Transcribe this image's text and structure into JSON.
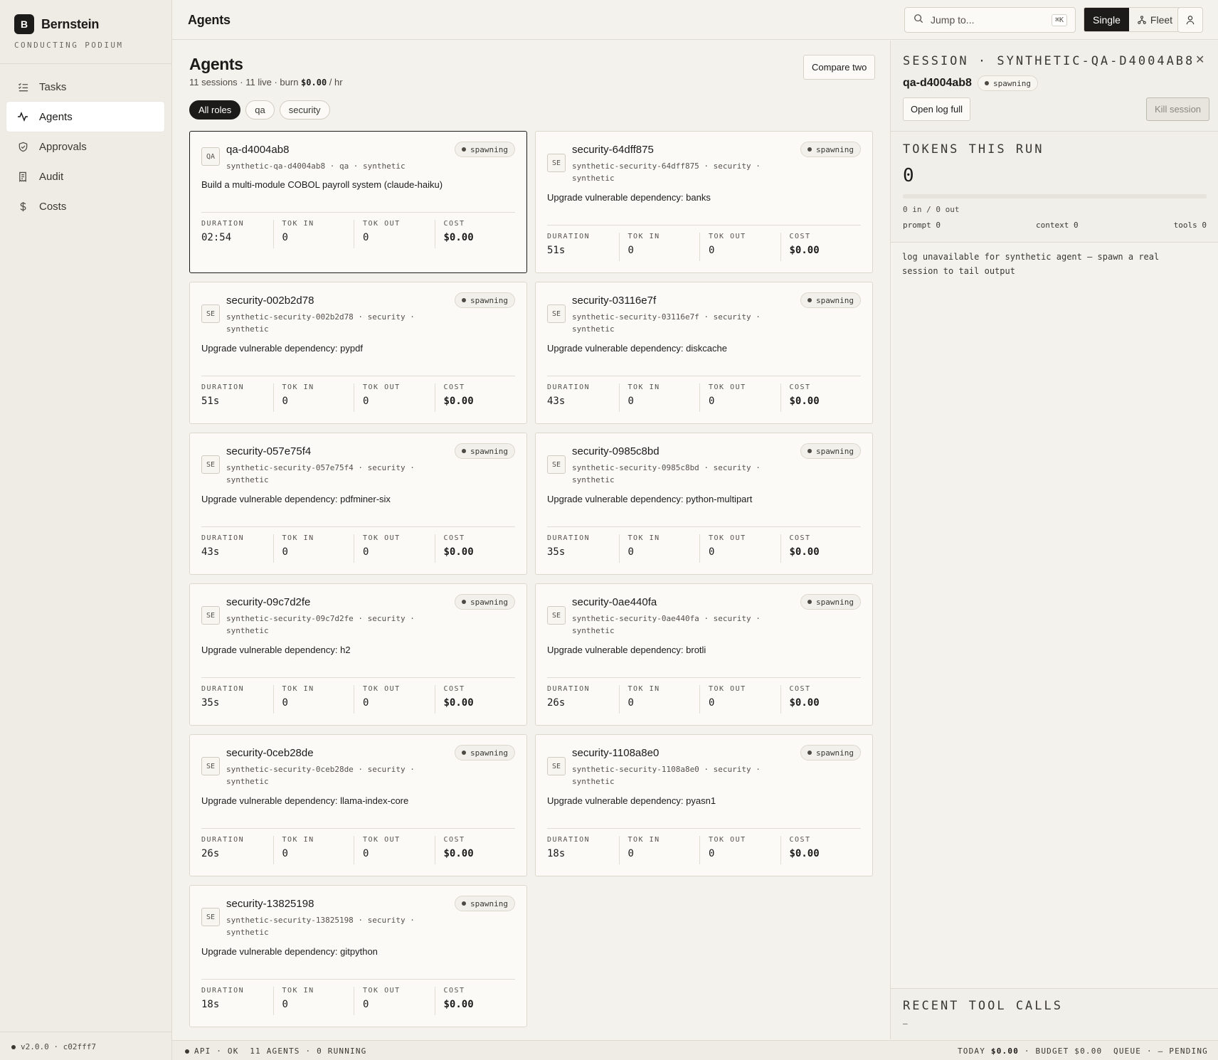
{
  "brand": {
    "logo_letter": "B",
    "name": "Bernstein",
    "tagline": "CONDUCTING PODIUM"
  },
  "nav": [
    {
      "label": "Tasks",
      "icon": "list-check-icon"
    },
    {
      "label": "Agents",
      "icon": "activity-icon",
      "active": true
    },
    {
      "label": "Approvals",
      "icon": "shield-check-icon"
    },
    {
      "label": "Audit",
      "icon": "receipt-icon"
    },
    {
      "label": "Costs",
      "icon": "dollar-icon"
    }
  ],
  "sidebar_footer": {
    "version": "v2.0.0 · c02fff7"
  },
  "header": {
    "title": "Agents",
    "search_placeholder": "Jump to...",
    "search_shortcut": "⌘K",
    "view_single": "Single",
    "view_fleet": "Fleet"
  },
  "main": {
    "title": "Agents",
    "summary_prefix": "11 sessions · 11 live · burn ",
    "burn": "$0.00",
    "summary_suffix": " / hr",
    "compare_label": "Compare two",
    "filters": [
      "All roles",
      "qa",
      "security"
    ],
    "stat_labels": {
      "duration": "DURATION",
      "tok_in": "TOK IN",
      "tok_out": "TOK OUT",
      "cost": "COST"
    }
  },
  "agents": [
    {
      "role": "QA",
      "name": "qa-d4004ab8",
      "meta": "synthetic-qa-d4004ab8 · qa · synthetic",
      "status": "spawning",
      "task": "Build a multi-module COBOL payroll system (claude-haiku)",
      "duration": "02:54",
      "tok_in": "0",
      "tok_out": "0",
      "cost": "$0.00",
      "selected": true
    },
    {
      "role": "SE",
      "name": "security-64dff875",
      "meta": "synthetic-security-64dff875 · security · synthetic",
      "status": "spawning",
      "task": "Upgrade vulnerable dependency: banks",
      "duration": "51s",
      "tok_in": "0",
      "tok_out": "0",
      "cost": "$0.00"
    },
    {
      "role": "SE",
      "name": "security-002b2d78",
      "meta": "synthetic-security-002b2d78 · security · synthetic",
      "status": "spawning",
      "task": "Upgrade vulnerable dependency: pypdf",
      "duration": "51s",
      "tok_in": "0",
      "tok_out": "0",
      "cost": "$0.00"
    },
    {
      "role": "SE",
      "name": "security-03116e7f",
      "meta": "synthetic-security-03116e7f · security · synthetic",
      "status": "spawning",
      "task": "Upgrade vulnerable dependency: diskcache",
      "duration": "43s",
      "tok_in": "0",
      "tok_out": "0",
      "cost": "$0.00"
    },
    {
      "role": "SE",
      "name": "security-057e75f4",
      "meta": "synthetic-security-057e75f4 · security · synthetic",
      "status": "spawning",
      "task": "Upgrade vulnerable dependency: pdfminer-six",
      "duration": "43s",
      "tok_in": "0",
      "tok_out": "0",
      "cost": "$0.00"
    },
    {
      "role": "SE",
      "name": "security-0985c8bd",
      "meta": "synthetic-security-0985c8bd · security · synthetic",
      "status": "spawning",
      "task": "Upgrade vulnerable dependency: python-multipart",
      "duration": "35s",
      "tok_in": "0",
      "tok_out": "0",
      "cost": "$0.00"
    },
    {
      "role": "SE",
      "name": "security-09c7d2fe",
      "meta": "synthetic-security-09c7d2fe · security · synthetic",
      "status": "spawning",
      "task": "Upgrade vulnerable dependency: h2",
      "duration": "35s",
      "tok_in": "0",
      "tok_out": "0",
      "cost": "$0.00"
    },
    {
      "role": "SE",
      "name": "security-0ae440fa",
      "meta": "synthetic-security-0ae440fa · security · synthetic",
      "status": "spawning",
      "task": "Upgrade vulnerable dependency: brotli",
      "duration": "26s",
      "tok_in": "0",
      "tok_out": "0",
      "cost": "$0.00"
    },
    {
      "role": "SE",
      "name": "security-0ceb28de",
      "meta": "synthetic-security-0ceb28de · security · synthetic",
      "status": "spawning",
      "task": "Upgrade vulnerable dependency: llama-index-core",
      "duration": "26s",
      "tok_in": "0",
      "tok_out": "0",
      "cost": "$0.00"
    },
    {
      "role": "SE",
      "name": "security-1108a8e0",
      "meta": "synthetic-security-1108a8e0 · security · synthetic",
      "status": "spawning",
      "task": "Upgrade vulnerable dependency: pyasn1",
      "duration": "18s",
      "tok_in": "0",
      "tok_out": "0",
      "cost": "$0.00"
    },
    {
      "role": "SE",
      "name": "security-13825198",
      "meta": "synthetic-security-13825198 · security · synthetic",
      "status": "spawning",
      "task": "Upgrade vulnerable dependency: gitpython",
      "duration": "18s",
      "tok_in": "0",
      "tok_out": "0",
      "cost": "$0.00"
    }
  ],
  "session": {
    "title": "SESSION · SYNTHETIC-QA-D4004AB8",
    "name": "qa-d4004ab8",
    "status": "spawning",
    "open_log_label": "Open log full",
    "kill_label": "Kill session",
    "tokens_title": "TOKENS THIS RUN",
    "tokens_total": "0",
    "tokens_fraction": 0,
    "tokens_io": "0 in / 0 out",
    "prompt": "prompt 0",
    "context": "context 0",
    "tools": "tools 0",
    "log": "log unavailable for synthetic agent — spawn a real session to tail output",
    "recent_title": "RECENT TOOL CALLS",
    "recent_empty": "—"
  },
  "statusbar": {
    "left": "API · OK  11 AGENTS · 0 RUNNING",
    "today_label": "TODAY ",
    "today_value": "$0.00",
    "rest": " · BUDGET $0.00  QUEUE · — PENDING"
  }
}
